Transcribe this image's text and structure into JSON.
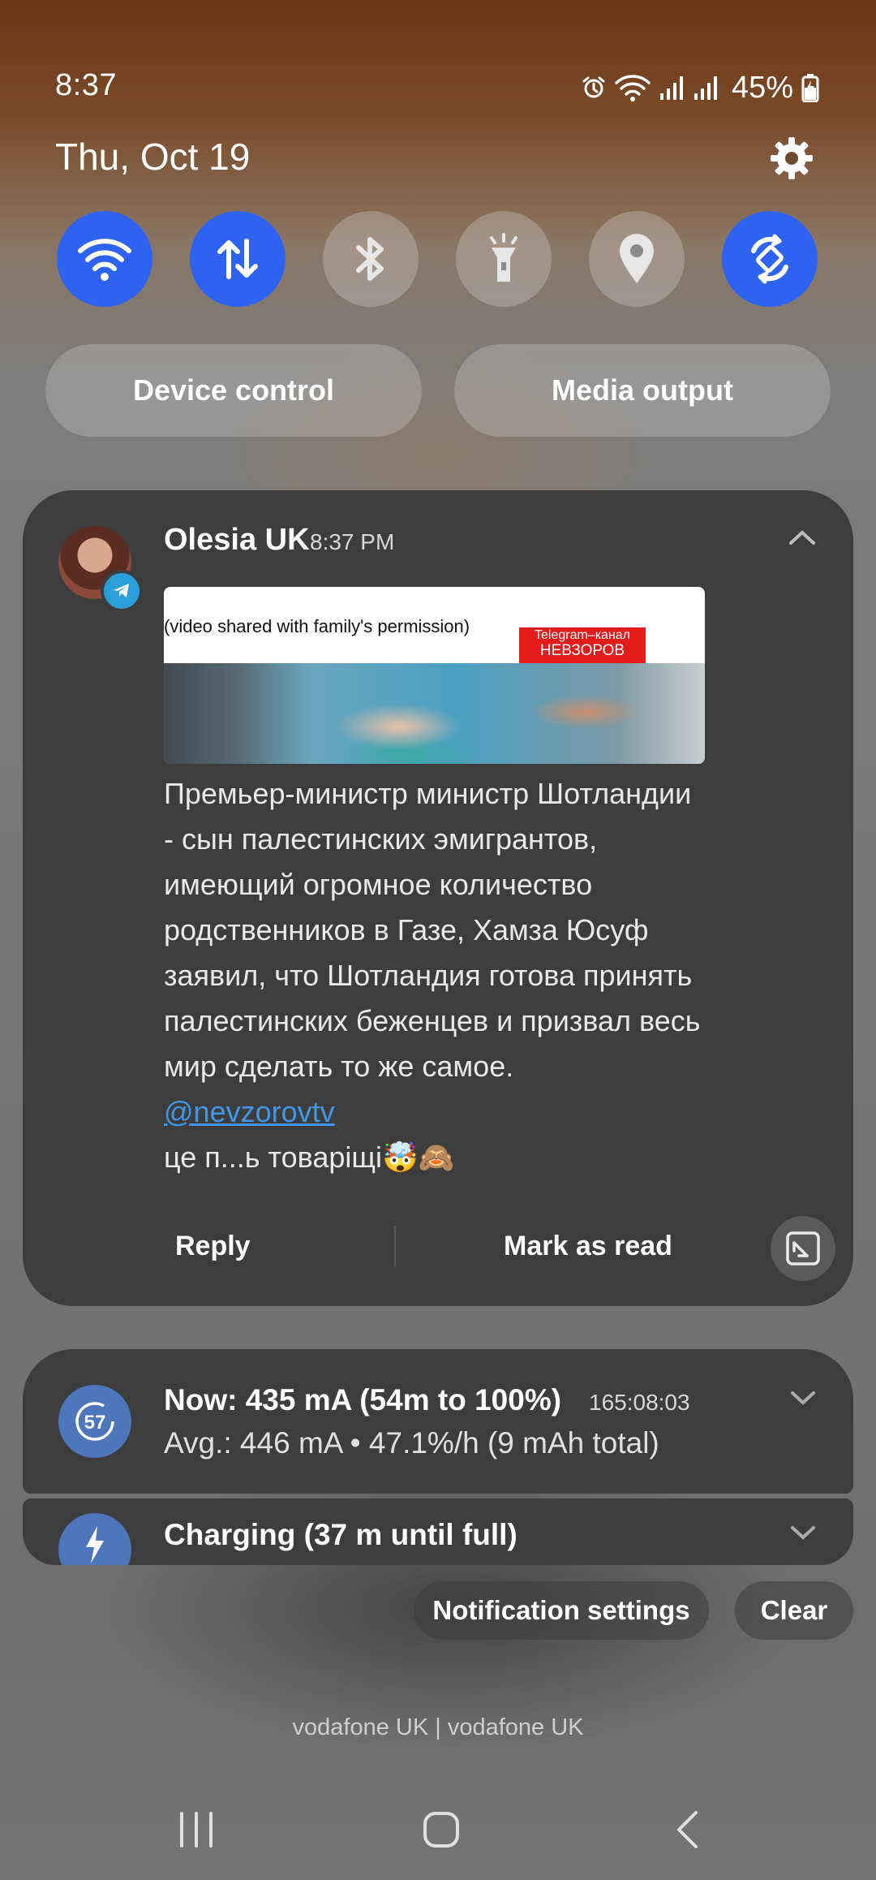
{
  "status_bar": {
    "time": "8:37",
    "battery_percent": "45%",
    "icons": [
      "alarm-icon",
      "wifi-icon",
      "signal-icon",
      "signal-icon",
      "battery-charging-icon"
    ]
  },
  "header": {
    "date": "Thu, Oct 19",
    "settings_icon": "gear-icon"
  },
  "quick_settings": {
    "toggles": [
      {
        "name": "wifi",
        "icon": "wifi-icon",
        "on": true
      },
      {
        "name": "mobile-data",
        "icon": "data-arrows-icon",
        "on": true
      },
      {
        "name": "bluetooth",
        "icon": "bluetooth-icon",
        "on": false
      },
      {
        "name": "flashlight",
        "icon": "flashlight-icon",
        "on": false
      },
      {
        "name": "location",
        "icon": "location-pin-icon",
        "on": false
      },
      {
        "name": "auto-rotate",
        "icon": "rotate-icon",
        "on": true
      }
    ],
    "device_control": "Device control",
    "media_output": "Media output",
    "accent_color": "#2e63f2"
  },
  "telegram_notification": {
    "sender": "Olesia UK",
    "time": "8:37 PM",
    "media_caption": "(video shared with family's permission)",
    "media_tag_line1": "Telegram–канал",
    "media_tag_line2": "НЕВЗОРОВ",
    "message_lines": [
      "Премьер-министр министр Шотландии",
      "- сын палестинских эмигрантов,",
      "имеющий огромное количество",
      "родственников в Газе, Хамза Юсуф",
      "заявил, что Шотландия готова принять",
      "палестинских беженцев и призвал весь",
      "мир сделать то же  самое."
    ],
    "link": "@nevzorovtv",
    "footer_line": "це п...ь товаріщі🤯🙈",
    "reply": "Reply",
    "mark_as_read": "Mark as read"
  },
  "battery_notification": {
    "title": "Now: 435 mA (54m to 100%)",
    "elapsed": "165:08:03",
    "subtitle": "Avg.: 446 mA • 47.1%/h (9 mAh total)",
    "icon_value": "57"
  },
  "charging_notification": {
    "title": "Charging (37 m until full)"
  },
  "actions": {
    "notification_settings": "Notification settings",
    "clear": "Clear"
  },
  "carrier": "vodafone UK | vodafone UK"
}
